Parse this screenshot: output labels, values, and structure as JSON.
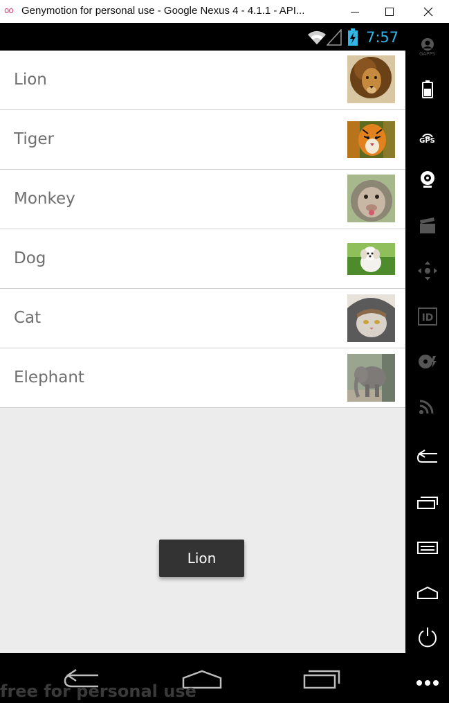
{
  "window": {
    "title": "Genymotion for personal use - Google Nexus 4 - 4.1.1 - API...",
    "logo": "oo",
    "controls": [
      "minimize",
      "maximize",
      "close"
    ]
  },
  "status_bar": {
    "time": "7:57",
    "icons": [
      "wifi-icon",
      "signal-icon",
      "battery-charging-icon"
    ],
    "accent_color": "#33b5e5"
  },
  "list": {
    "items": [
      {
        "label": "Lion",
        "image": "lion"
      },
      {
        "label": "Tiger",
        "image": "tiger"
      },
      {
        "label": "Monkey",
        "image": "monkey"
      },
      {
        "label": "Dog",
        "image": "dog"
      },
      {
        "label": "Cat",
        "image": "cat"
      },
      {
        "label": "Elephant",
        "image": "elephant"
      }
    ]
  },
  "toast": {
    "text": "Lion"
  },
  "navigation_bar": {
    "buttons": [
      "back-icon",
      "home-icon",
      "recent-apps-icon"
    ]
  },
  "watermark": "free for personal use",
  "sidebar": {
    "gapps_label": "GAPPS",
    "gps_label": "GPS",
    "id_label": "ID",
    "buttons": [
      "gapps",
      "battery",
      "gps",
      "webcam",
      "screencast",
      "dpad",
      "identifiers",
      "disk-io",
      "remote-control",
      "back",
      "recent-apps",
      "menu",
      "home",
      "power",
      "more"
    ]
  }
}
